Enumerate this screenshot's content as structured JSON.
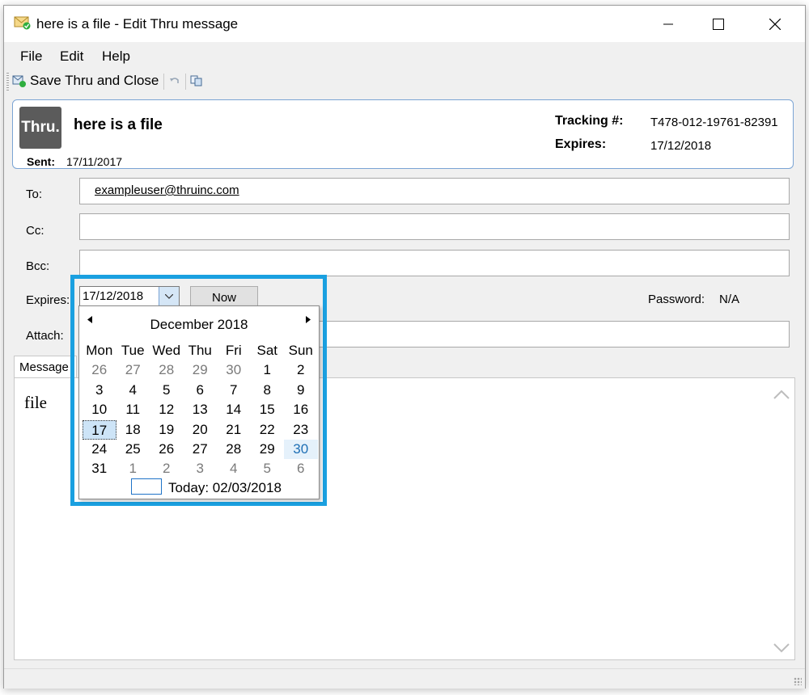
{
  "window": {
    "title": "here is a file - Edit Thru message",
    "icon": "envelope-icon"
  },
  "menu": {
    "items": [
      "File",
      "Edit",
      "Help"
    ]
  },
  "toolbar": {
    "save_label": "Save Thru and Close",
    "icons": [
      "save-icon",
      "undo-icon",
      "copy-icon"
    ]
  },
  "header": {
    "logo_text": "Thru.",
    "subject": "here is a file",
    "sent_label": "Sent:",
    "sent_value": "17/11/2017",
    "tracking_label": "Tracking #:",
    "tracking_value": "T478-012-19761-82391",
    "expires_label": "Expires:",
    "expires_value": "17/12/2018"
  },
  "fields": {
    "to_label": "To:",
    "to_value": "exampleuser@thruinc.com",
    "cc_label": "Cc:",
    "cc_value": "",
    "bcc_label": "Bcc:",
    "bcc_value": "",
    "expires_label": "Expires:",
    "expires_value": "17/12/2018",
    "now_label": "Now",
    "password_label": "Password:",
    "password_value": "N/A",
    "attach_label": "Attach:"
  },
  "message": {
    "tab_label": "Message",
    "body": "file"
  },
  "calendar": {
    "month_label": "December 2018",
    "weekdays": [
      "Mon",
      "Tue",
      "Wed",
      "Thu",
      "Fri",
      "Sat",
      "Sun"
    ],
    "weeks": [
      [
        "26",
        "27",
        "28",
        "29",
        "30",
        "1",
        "2"
      ],
      [
        "3",
        "4",
        "5",
        "6",
        "7",
        "8",
        "9"
      ],
      [
        "10",
        "11",
        "12",
        "13",
        "14",
        "15",
        "16"
      ],
      [
        "17",
        "18",
        "19",
        "20",
        "21",
        "22",
        "23"
      ],
      [
        "24",
        "25",
        "26",
        "27",
        "28",
        "29",
        "30"
      ],
      [
        "31",
        "1",
        "2",
        "3",
        "4",
        "5",
        "6"
      ]
    ],
    "selected_day": "17",
    "hovered_day": "30",
    "today_label": "Today: 02/03/2018"
  },
  "colors": {
    "highlight": "#1aa0e0",
    "header_border": "#7aa4d4",
    "logo_bg": "#5b5b5b",
    "selection_bg": "#cde4f7"
  }
}
